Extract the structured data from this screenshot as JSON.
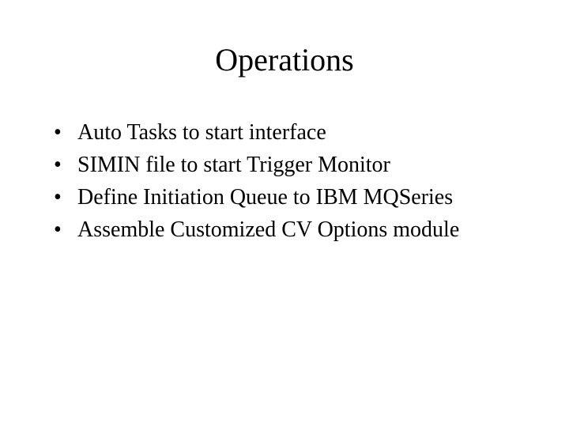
{
  "title": "Operations",
  "bullets": [
    "Auto Tasks to start interface",
    "SIMIN file to start Trigger Monitor",
    "Define Initiation Queue to IBM MQSeries",
    "Assemble Customized CV Options module"
  ]
}
